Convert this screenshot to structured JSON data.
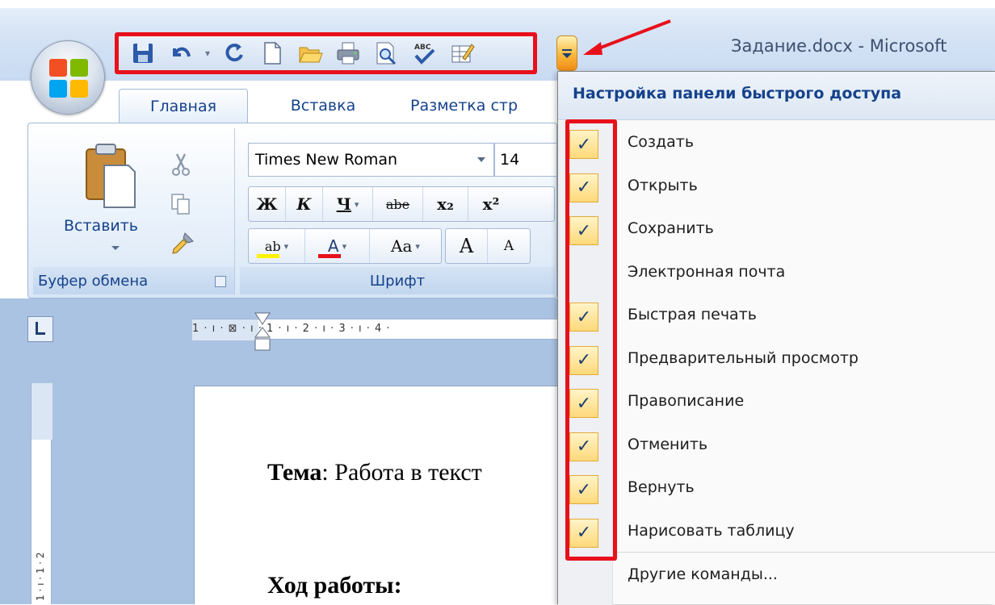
{
  "window": {
    "title": "Задание.docx - Microsoft"
  },
  "ribbon": {
    "tabs": [
      {
        "label": "Главная"
      },
      {
        "label": "Вставка"
      },
      {
        "label": "Разметка стр"
      }
    ],
    "clipboard": {
      "paste_label": "Вставить",
      "group_label": "Буфер обмена"
    },
    "font": {
      "name": "Times New Roman",
      "size": "14",
      "group_label": "Шрифт",
      "bold": "Ж",
      "italic": "К",
      "underline": "Ч",
      "strike": "abe",
      "subscript": "x₂",
      "superscript": "x²",
      "highlight": "ab",
      "color": "A",
      "case": "Aa",
      "grow": "A",
      "shrink": "A"
    }
  },
  "ruler": {
    "ticks": "1 · ı · ⊠ · ı · 1 · ı · 2 · ı · 3 · ı · 4 ·",
    "vertical": "1 · ı · 1 · 2"
  },
  "document": {
    "line1_bold": "Тема",
    "line1_rest": ": Работа в текст",
    "line2": "Ход работы:"
  },
  "qat_menu": {
    "header": "Настройка панели быстрого доступа",
    "check_mark": "✓",
    "items": [
      {
        "label": "Создать",
        "checked": true
      },
      {
        "label": "Открыть",
        "checked": true
      },
      {
        "label": "Сохранить",
        "checked": true
      },
      {
        "label": "Электронная почта",
        "checked": false
      },
      {
        "label": "Быстрая печать",
        "checked": true
      },
      {
        "label": "Предварительный просмотр",
        "checked": true
      },
      {
        "label": "Правописание",
        "checked": true
      },
      {
        "label": "Отменить",
        "checked": true
      },
      {
        "label": "Вернуть",
        "checked": true
      },
      {
        "label": "Нарисовать таблицу",
        "checked": true
      }
    ],
    "more_commands": "Другие команды..."
  },
  "colors": {
    "annotation_red": "#e8101b",
    "ribbon_text": "#15428b",
    "check_bg": "#ffd97a"
  }
}
